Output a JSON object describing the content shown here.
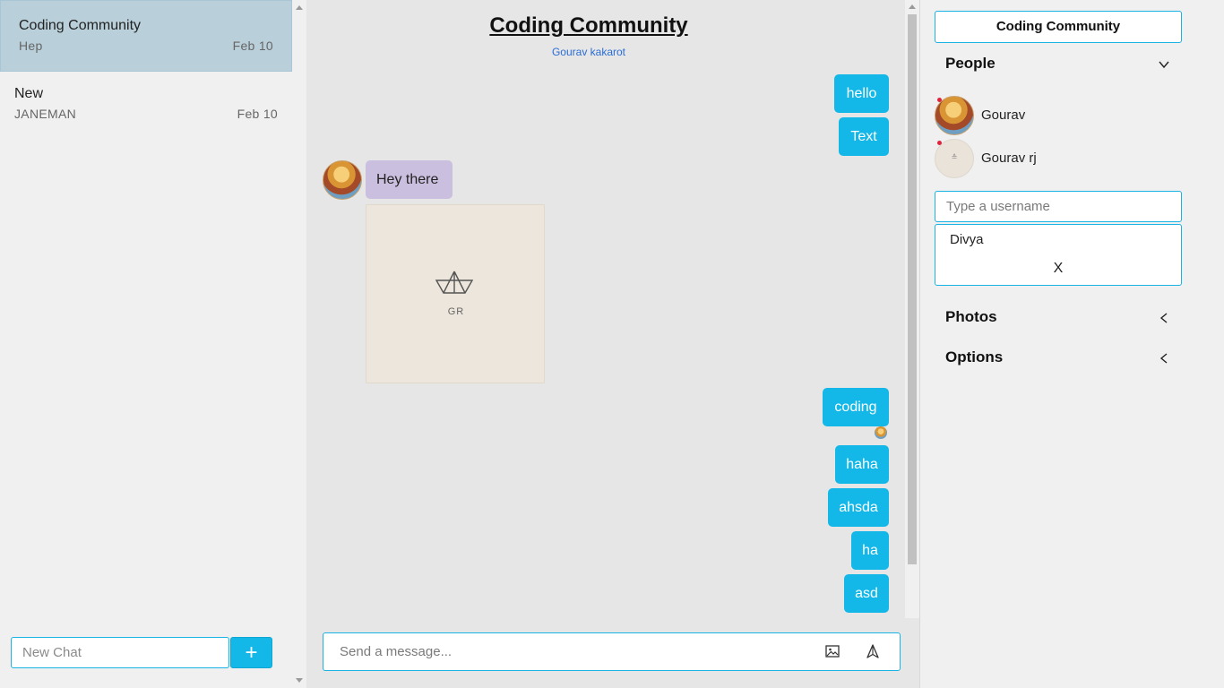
{
  "sidebar": {
    "chats": [
      {
        "title": "Coding Community",
        "last_message": "Hep",
        "date": "Feb 10"
      },
      {
        "title": "New",
        "last_message": "JANEMAN",
        "date": "Feb 10"
      }
    ],
    "new_chat_placeholder": "New Chat",
    "new_chat_button": "+"
  },
  "chat": {
    "title": "Coding Community",
    "subtitle": "Gourav kakarot",
    "image_label": "GR",
    "messages": [
      {
        "text": "hello",
        "sender": "me"
      },
      {
        "text": "Text",
        "sender": "me"
      },
      {
        "text": "Hey there",
        "sender": "other"
      },
      {
        "text": "coding",
        "sender": "me"
      },
      {
        "text": "haha",
        "sender": "me"
      },
      {
        "text": "ahsda",
        "sender": "me"
      },
      {
        "text": "ha",
        "sender": "me"
      },
      {
        "text": "asd",
        "sender": "me"
      }
    ],
    "composer_placeholder": "Send a message..."
  },
  "details": {
    "title": "Coding Community",
    "people_label": "People",
    "people": [
      {
        "name": "Gourav"
      },
      {
        "name": "Gourav rj"
      }
    ],
    "username_placeholder": "Type a username",
    "suggestion": "Divya",
    "suggestion_close": "X",
    "photos_label": "Photos",
    "options_label": "Options"
  },
  "colors": {
    "accent": "#14b8e8",
    "active_chat": "#b9d0db",
    "other_bubble": "#cbbfdf",
    "online_dot": "#e0243e"
  }
}
